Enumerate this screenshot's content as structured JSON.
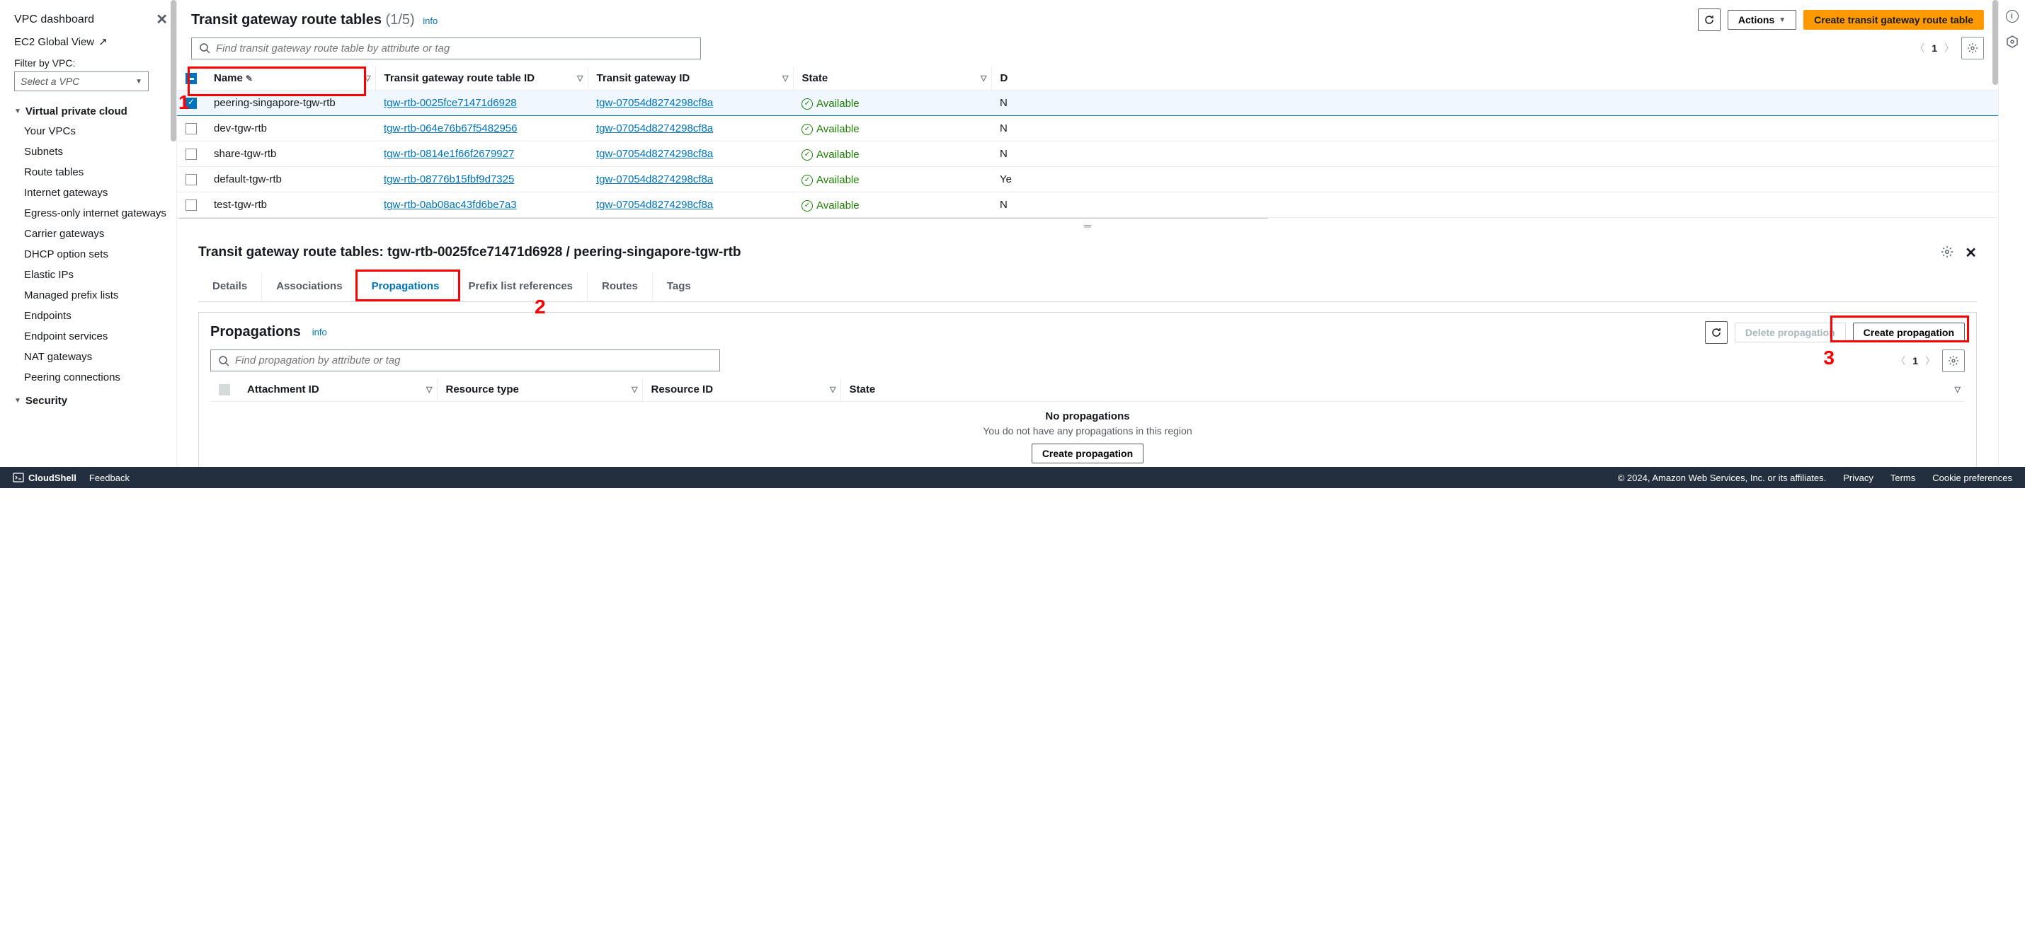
{
  "sidebar": {
    "dashboard": "VPC dashboard",
    "ec2_global": "EC2 Global View",
    "filter_label": "Filter by VPC:",
    "select_placeholder": "Select a VPC",
    "section_vpc": "Virtual private cloud",
    "items": [
      "Your VPCs",
      "Subnets",
      "Route tables",
      "Internet gateways",
      "Egress-only internet gateways",
      "Carrier gateways",
      "DHCP option sets",
      "Elastic IPs",
      "Managed prefix lists",
      "Endpoints",
      "Endpoint services",
      "NAT gateways",
      "Peering connections"
    ],
    "section_security": "Security"
  },
  "header": {
    "title": "Transit gateway route tables",
    "count": "(1/5)",
    "info": "info",
    "actions": "Actions",
    "create": "Create transit gateway route table"
  },
  "search": {
    "placeholder": "Find transit gateway route table by attribute or tag",
    "page": "1"
  },
  "columns": {
    "name": "Name",
    "rtb_id": "Transit gateway route table ID",
    "tgw_id": "Transit gateway ID",
    "state": "State",
    "d": "D"
  },
  "rows": [
    {
      "name": "peering-singapore-tgw-rtb",
      "rtb": "tgw-rtb-0025fce71471d6928",
      "tgw": "tgw-07054d8274298cf8a",
      "state": "Available",
      "d": "N",
      "sel": true
    },
    {
      "name": "dev-tgw-rtb",
      "rtb": "tgw-rtb-064e76b67f5482956",
      "tgw": "tgw-07054d8274298cf8a",
      "state": "Available",
      "d": "N",
      "sel": false
    },
    {
      "name": "share-tgw-rtb",
      "rtb": "tgw-rtb-0814e1f66f2679927",
      "tgw": "tgw-07054d8274298cf8a",
      "state": "Available",
      "d": "N",
      "sel": false
    },
    {
      "name": "default-tgw-rtb",
      "rtb": "tgw-rtb-08776b15fbf9d7325",
      "tgw": "tgw-07054d8274298cf8a",
      "state": "Available",
      "d": "Ye",
      "sel": false
    },
    {
      "name": "test-tgw-rtb",
      "rtb": "tgw-rtb-0ab08ac43fd6be7a3",
      "tgw": "tgw-07054d8274298cf8a",
      "state": "Available",
      "d": "N",
      "sel": false
    }
  ],
  "detail": {
    "title": "Transit gateway route tables: tgw-rtb-0025fce71471d6928 / peering-singapore-tgw-rtb",
    "tabs": [
      "Details",
      "Associations",
      "Propagations",
      "Prefix list references",
      "Routes",
      "Tags"
    ],
    "active_tab": 2,
    "panel_title": "Propagations",
    "info": "info",
    "delete": "Delete propagation",
    "create": "Create propagation",
    "search_placeholder": "Find propagation by attribute or tag",
    "page": "1",
    "cols": {
      "att": "Attachment ID",
      "rtype": "Resource type",
      "rid": "Resource ID",
      "state": "State"
    },
    "empty_title": "No propagations",
    "empty_sub": "You do not have any propagations in this region",
    "empty_btn": "Create propagation"
  },
  "footer": {
    "cloudshell": "CloudShell",
    "feedback": "Feedback",
    "copyright": "© 2024, Amazon Web Services, Inc. or its affiliates.",
    "privacy": "Privacy",
    "terms": "Terms",
    "cookie": "Cookie preferences"
  },
  "annotations": {
    "n1": "1",
    "n2": "2",
    "n3": "3"
  }
}
